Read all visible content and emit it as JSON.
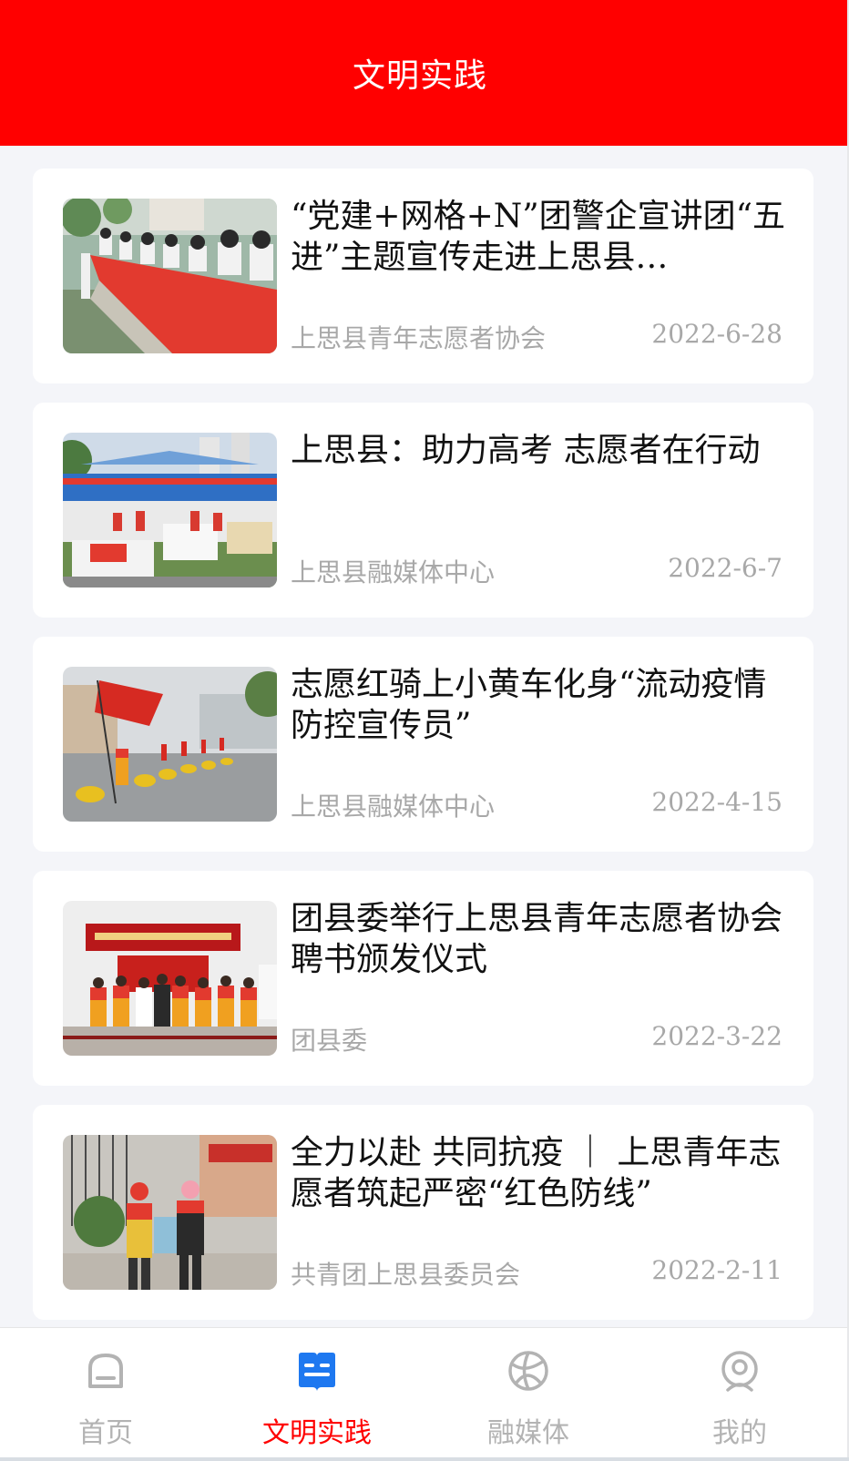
{
  "header": {
    "title": "文明实践"
  },
  "articles": [
    {
      "title": "“党建+网格+N”团警企宣讲团“五进”主题宣传走进上思县…",
      "source": "上思县青年志愿者协会",
      "date": "2022-6-28",
      "image": "students-signing-banner-photo"
    },
    {
      "title": "上思县：助力高考  志愿者在行动",
      "source": "上思县融媒体中心",
      "date": "2022-6-7",
      "image": "exam-volunteer-tent-photo"
    },
    {
      "title": "志愿红骑上小黄车化身“流动疫情防控宣传员”",
      "source": "上思县融媒体中心",
      "date": "2022-4-15",
      "image": "volunteers-flag-scooters-photo"
    },
    {
      "title": "团县委举行上思县青年志愿者协会聘书颁发仪式",
      "source": "团县委",
      "date": "2022-3-22",
      "image": "ceremony-group-photo"
    },
    {
      "title": "全力以赴  共同抗疫 ｜ 上思青年志愿者筑起严密“红色防线”",
      "source": "共青团上思县委员会",
      "date": "2022-2-11",
      "image": "volunteers-checkpoint-photo"
    }
  ],
  "tabbar": {
    "tabs": [
      {
        "label": "首页",
        "icon": "home-icon",
        "active": false
      },
      {
        "label": "文明实践",
        "icon": "book-open-icon",
        "active": true
      },
      {
        "label": "融媒体",
        "icon": "globe-icon",
        "active": false
      },
      {
        "label": "我的",
        "icon": "user-icon",
        "active": false
      }
    ]
  },
  "colors": {
    "brand": "#ff0000",
    "active_tab": "#ff0000",
    "active_icon": "#1e78f0",
    "inactive": "#b3b3b3",
    "background": "#f4f5f9"
  }
}
